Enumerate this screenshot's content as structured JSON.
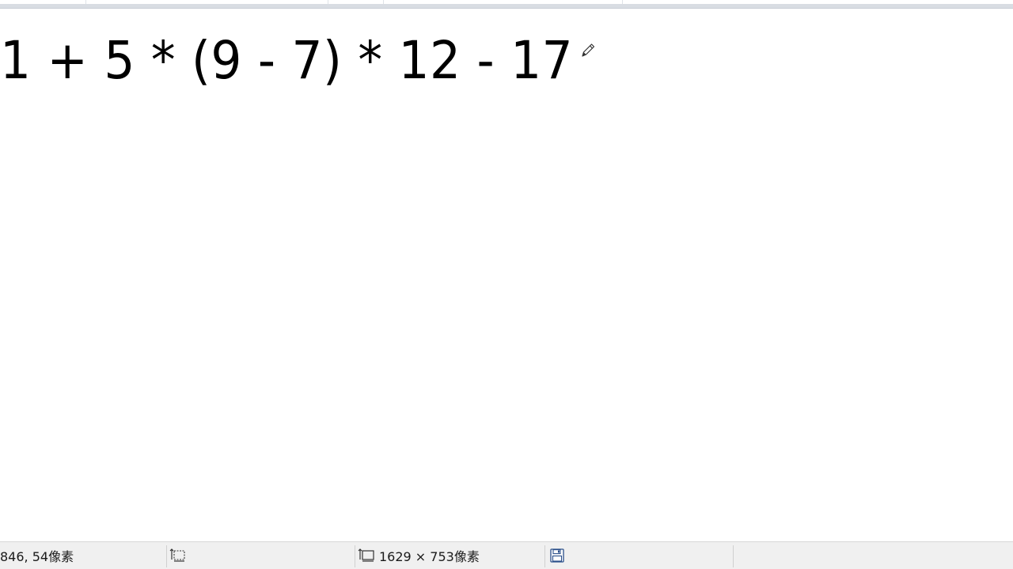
{
  "canvas": {
    "expression": "1 + 5 * (9 - 7) * 12 - 17"
  },
  "statusbar": {
    "cursor_position": "846, 54像素",
    "selection_size": "",
    "image_size": "1629 × 753像素",
    "file_size": ""
  },
  "icons": {
    "cursor": "pencil-icon",
    "selection": "selection-icon",
    "image_size": "image-size-icon",
    "file_size": "save-disk-icon"
  }
}
